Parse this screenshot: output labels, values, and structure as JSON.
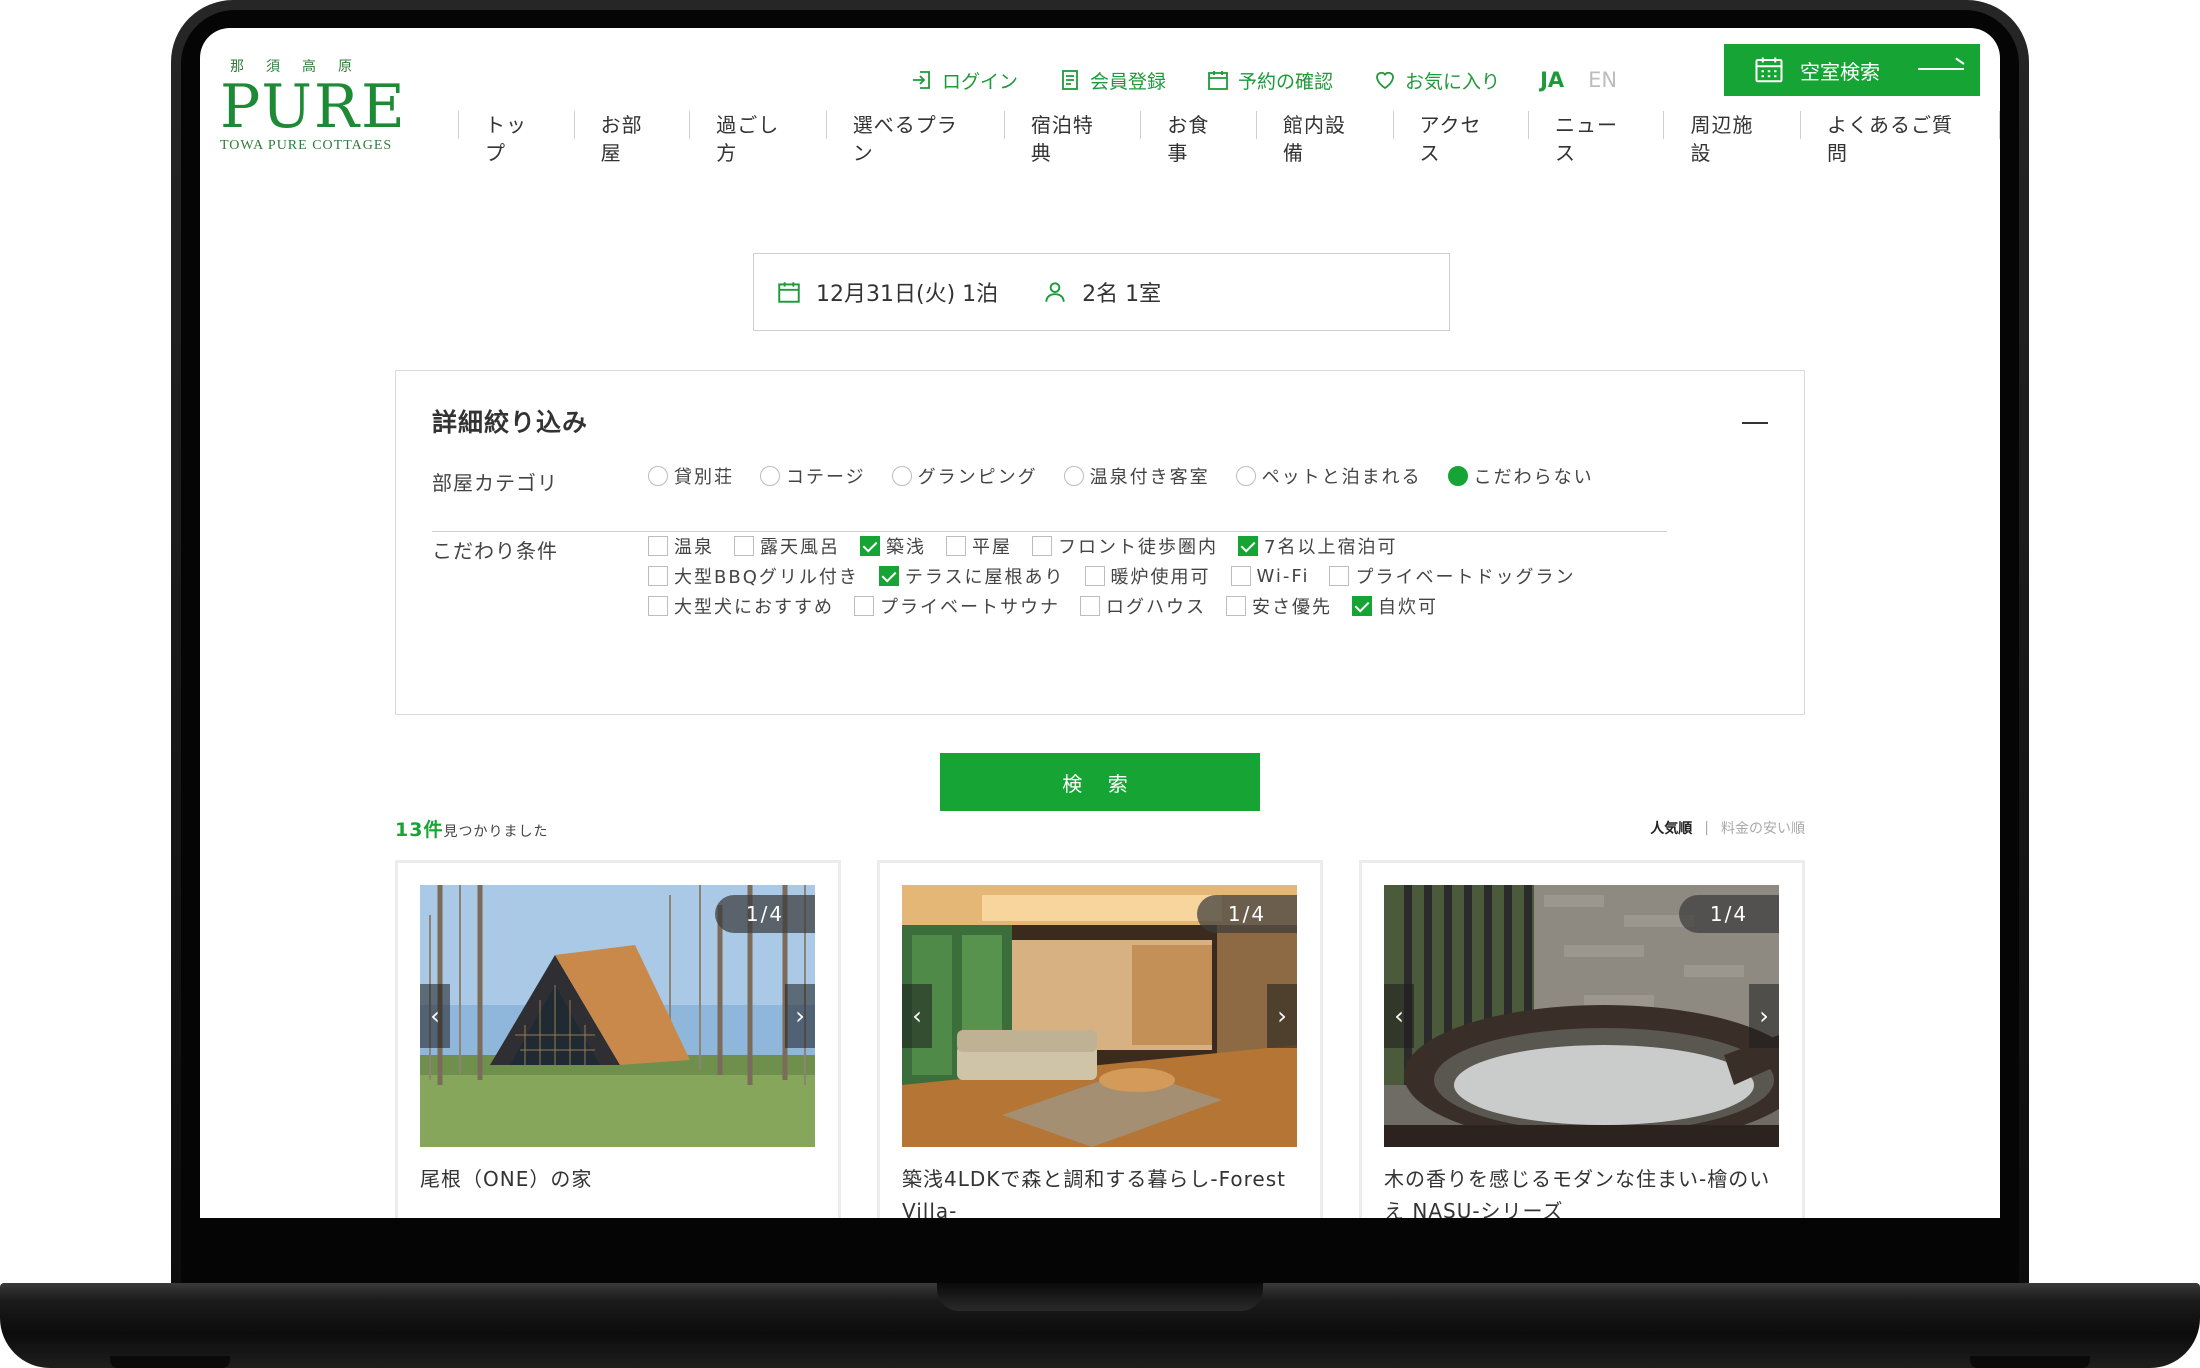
{
  "brand": {
    "kanji": "那須高原",
    "name": "PURE",
    "subtitle": "TOWA PURE COTTAGES",
    "color": "#1e8a35"
  },
  "topnav": {
    "login": "ログイン",
    "register": "会員登録",
    "reservation": "予約の確認",
    "favorites": "お気に入り",
    "lang_ja": "JA",
    "lang_en": "EN",
    "vacancy": "空室検索"
  },
  "mainnav": [
    "トップ",
    "お部屋",
    "過ごし方",
    "選べるプラン",
    "宿泊特典",
    "お食事",
    "館内設備",
    "アクセス",
    "ニュース",
    "周辺施設",
    "よくあるご質問"
  ],
  "summary": {
    "date": "12月31日(火) 1泊",
    "guests": "2名 1室"
  },
  "filter": {
    "title": "詳細絞り込み",
    "category_label": "部屋カテゴリ",
    "categories": [
      {
        "label": "貸別荘",
        "selected": false
      },
      {
        "label": "コテージ",
        "selected": false
      },
      {
        "label": "グランピング",
        "selected": false
      },
      {
        "label": "温泉付き客室",
        "selected": false
      },
      {
        "label": "ペットと泊まれる",
        "selected": false
      },
      {
        "label": "こだわらない",
        "selected": true
      }
    ],
    "condition_label": "こだわり条件",
    "conditions": [
      [
        {
          "label": "温泉",
          "checked": false
        },
        {
          "label": "露天風呂",
          "checked": false
        },
        {
          "label": "築浅",
          "checked": true
        },
        {
          "label": "平屋",
          "checked": false
        },
        {
          "label": "フロント徒歩圏内",
          "checked": false
        },
        {
          "label": "7名以上宿泊可",
          "checked": true
        }
      ],
      [
        {
          "label": "大型BBQグリル付き",
          "checked": false
        },
        {
          "label": "テラスに屋根あり",
          "checked": true
        },
        {
          "label": "暖炉使用可",
          "checked": false
        },
        {
          "label": "Wi-Fi",
          "checked": false
        },
        {
          "label": "プライベートドッグラン",
          "checked": false
        }
      ],
      [
        {
          "label": "大型犬におすすめ",
          "checked": false
        },
        {
          "label": "プライベートサウナ",
          "checked": false
        },
        {
          "label": "ログハウス",
          "checked": false
        },
        {
          "label": "安さ優先",
          "checked": false
        },
        {
          "label": "自炊可",
          "checked": true
        }
      ]
    ]
  },
  "search_button": "検 索",
  "results": {
    "count": "13件",
    "found": "見つかりました"
  },
  "sort": {
    "popular": "人気順",
    "cheap": "料金の安い順"
  },
  "cards": [
    {
      "pager": "1/4",
      "title": "尾根（ONE）の家"
    },
    {
      "pager": "1/4",
      "title": "築浅4LDKで森と調和する暮らし-Forest Villa-"
    },
    {
      "pager": "1/4",
      "title": "木の香りを感じるモダンな住まい-檜のいえ NASU-シリーズ"
    }
  ],
  "accent_color": "#16a434"
}
